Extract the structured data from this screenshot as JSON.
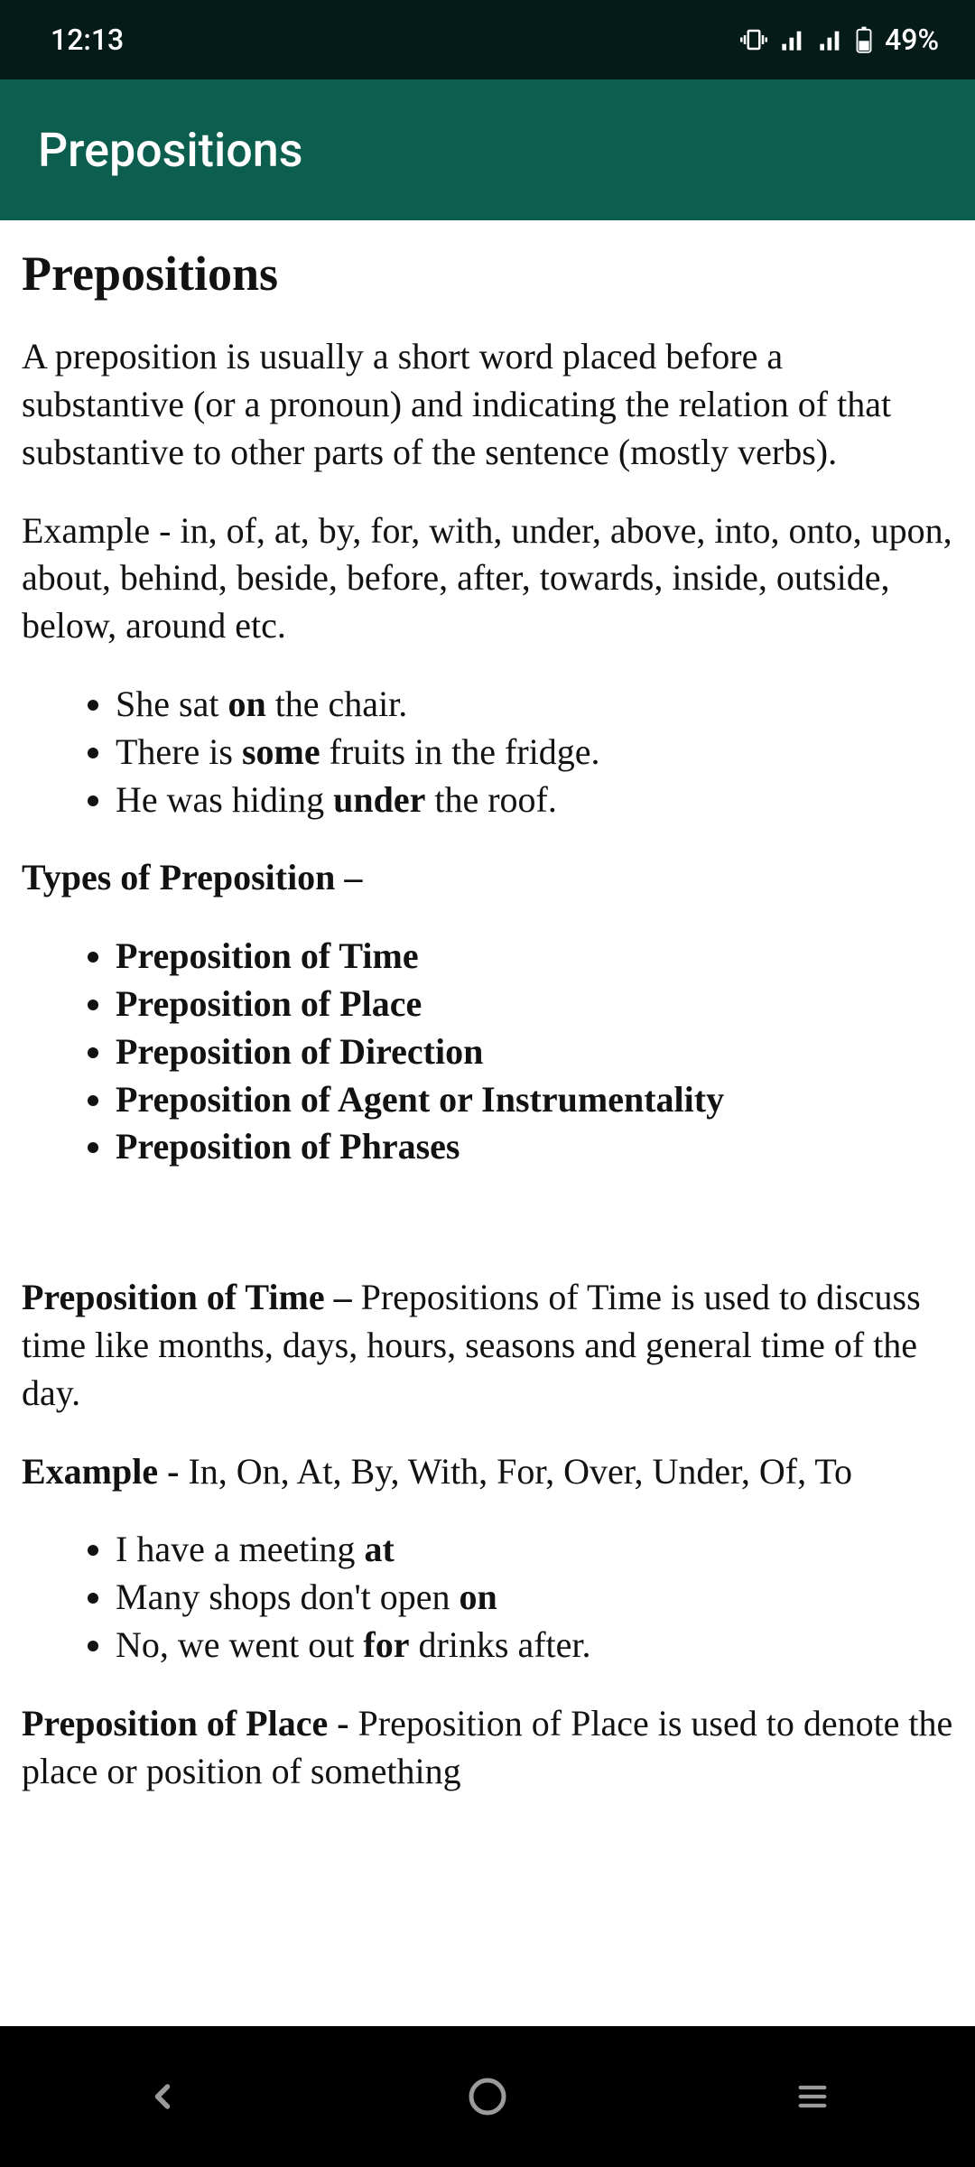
{
  "status": {
    "time": "12:13",
    "battery_pct": "49%"
  },
  "appbar": {
    "title": "Prepositions"
  },
  "doc": {
    "heading": "Prepositions",
    "definition": "A preposition is usually a short word placed before a substantive (or a pronoun) and indicating the relation of that substantive to other parts of the sentence (mostly verbs).",
    "example_intro": "Example - in, of, at, by, for, with, under, above, into, onto, upon, about, behind, beside, before, after, towards, inside, outside, below, around etc.",
    "sentence1_pre": "She sat ",
    "sentence1_bold": "on",
    "sentence1_post": " the chair.",
    "sentence2_pre": "There is ",
    "sentence2_bold": "some",
    "sentence2_post": " fruits in the fridge.",
    "sentence3_pre": "He was hiding ",
    "sentence3_bold": "under",
    "sentence3_post": " the roof.",
    "types_heading": "Types of Preposition –",
    "types": {
      "t1": "Preposition of Time",
      "t2": "Preposition of Place",
      "t3": "Preposition of Direction",
      "t4": "Preposition of Agent or Instrumentality",
      "t5": "Preposition of Phrases"
    },
    "time_label": "Preposition of Time – ",
    "time_body": "Prepositions of Time is used to discuss time like months, days, hours, seasons and general time of the day.",
    "time_example_label": "Example - ",
    "time_example_body": "In, On, At, By, With, For, Over, Under, Of, To",
    "time_s1_pre": "I have a meeting ",
    "time_s1_bold": "at",
    "time_s2_pre": "Many shops don't open ",
    "time_s2_bold": "on",
    "time_s3_pre": "No, we went out ",
    "time_s3_bold": "for",
    "time_s3_post": " drinks after.",
    "place_label": "Preposition of Place - ",
    "place_body": "Preposition of Place is used to denote the place or position of something"
  }
}
